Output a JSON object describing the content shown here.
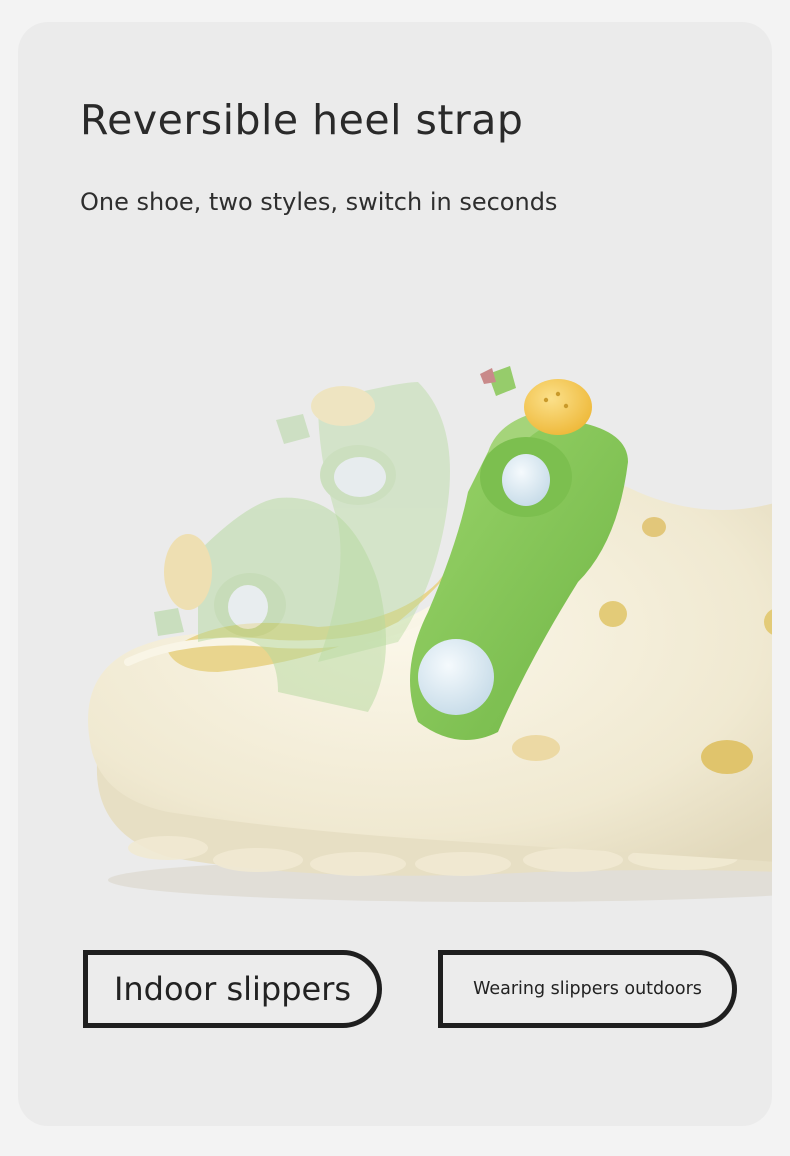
{
  "heading": {
    "title": "Reversible heel strap",
    "subtitle": "One shoe, two styles, switch in seconds"
  },
  "illustration": {
    "subject": "slipper-with-reversible-heel-strap",
    "colors": {
      "background": "#ebebeb",
      "shoe_body": "#f1ebd6",
      "shoe_inner": "#e9d58e",
      "strap_green": "#86c35a",
      "button_blue": "#dbe9f1",
      "mushroom_cap": "#f3c54c"
    }
  },
  "modes": {
    "indoor": "Indoor slippers",
    "outdoor": "Wearing slippers outdoors"
  }
}
